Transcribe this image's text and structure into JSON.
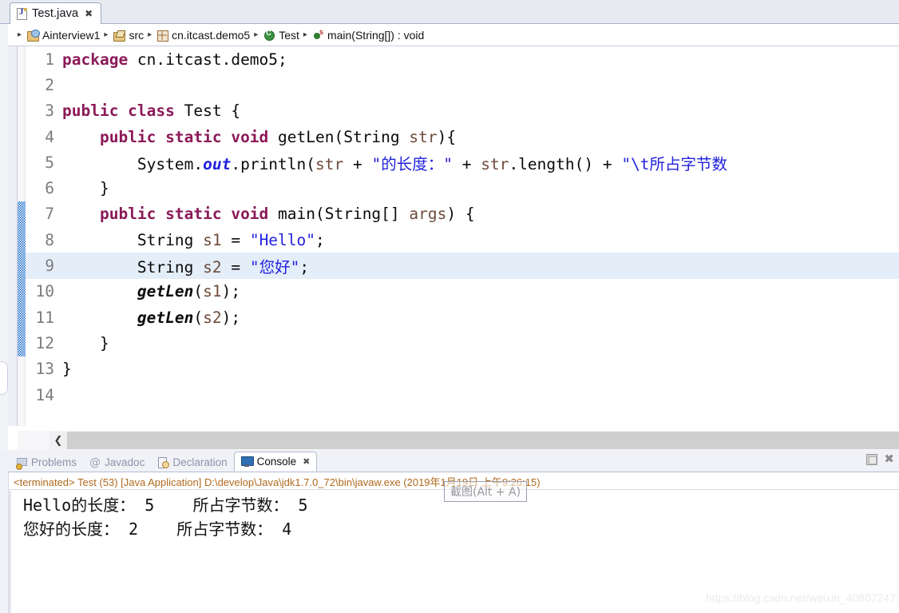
{
  "window": {
    "editor_tab": {
      "label": "Test.java",
      "icon": "java-file-icon",
      "close_glyph": "✖"
    }
  },
  "breadcrumb": {
    "items": [
      {
        "label": "Ainterview1",
        "icon": "java-project-icon"
      },
      {
        "label": "src",
        "icon": "source-folder-icon"
      },
      {
        "label": "cn.itcast.demo5",
        "icon": "package-icon"
      },
      {
        "label": "Test",
        "icon": "java-class-icon"
      },
      {
        "label": "main(String[]) : void",
        "icon": "static-method-icon"
      }
    ],
    "separator": "▸"
  },
  "editor": {
    "current_line": 9,
    "change_bar_from_line": 7,
    "change_bar_to_line": 12,
    "scroll_left_glyph": "❮",
    "lines": [
      {
        "n": "1",
        "tokens": [
          {
            "t": "package",
            "c": "kw"
          },
          {
            "t": " cn.itcast.demo5;",
            "c": "pln"
          }
        ]
      },
      {
        "n": "2",
        "tokens": [
          {
            "t": "",
            "c": "pln"
          }
        ]
      },
      {
        "n": "3",
        "tokens": [
          {
            "t": "public class",
            "c": "kw"
          },
          {
            "t": " Test {",
            "c": "pln"
          }
        ]
      },
      {
        "n": "4",
        "tokens": [
          {
            "t": "    ",
            "c": "pln"
          },
          {
            "t": "public static void",
            "c": "kw"
          },
          {
            "t": " getLen(String ",
            "c": "pln"
          },
          {
            "t": "str",
            "c": "prm"
          },
          {
            "t": "){",
            "c": "pln"
          }
        ]
      },
      {
        "n": "5",
        "tokens": [
          {
            "t": "        System.",
            "c": "pln"
          },
          {
            "t": "out",
            "c": "fld"
          },
          {
            "t": ".println(",
            "c": "pln"
          },
          {
            "t": "str",
            "c": "prm"
          },
          {
            "t": " + ",
            "c": "pln"
          },
          {
            "t": "\"的长度：\"",
            "c": "str"
          },
          {
            "t": " + ",
            "c": "pln"
          },
          {
            "t": "str",
            "c": "prm"
          },
          {
            "t": ".length() + ",
            "c": "pln"
          },
          {
            "t": "\"\\t所占字节数",
            "c": "str"
          }
        ]
      },
      {
        "n": "6",
        "tokens": [
          {
            "t": "    }",
            "c": "pln"
          }
        ]
      },
      {
        "n": "7",
        "tokens": [
          {
            "t": "    ",
            "c": "pln"
          },
          {
            "t": "public static void",
            "c": "kw"
          },
          {
            "t": " main(String[] ",
            "c": "pln"
          },
          {
            "t": "args",
            "c": "prm"
          },
          {
            "t": ") {",
            "c": "pln"
          }
        ]
      },
      {
        "n": "8",
        "tokens": [
          {
            "t": "        String ",
            "c": "pln"
          },
          {
            "t": "s1",
            "c": "prm"
          },
          {
            "t": " = ",
            "c": "pln"
          },
          {
            "t": "\"Hello\"",
            "c": "str"
          },
          {
            "t": ";",
            "c": "pln"
          }
        ]
      },
      {
        "n": "9",
        "tokens": [
          {
            "t": "        String ",
            "c": "pln"
          },
          {
            "t": "s2",
            "c": "prm"
          },
          {
            "t": " = ",
            "c": "pln"
          },
          {
            "t": "\"您好\"",
            "c": "str"
          },
          {
            "t": ";",
            "c": "pln"
          }
        ]
      },
      {
        "n": "10",
        "tokens": [
          {
            "t": "        ",
            "c": "pln"
          },
          {
            "t": "getLen",
            "c": "mth"
          },
          {
            "t": "(",
            "c": "pln"
          },
          {
            "t": "s1",
            "c": "prm"
          },
          {
            "t": ");",
            "c": "pln"
          }
        ]
      },
      {
        "n": "11",
        "tokens": [
          {
            "t": "        ",
            "c": "pln"
          },
          {
            "t": "getLen",
            "c": "mth"
          },
          {
            "t": "(",
            "c": "pln"
          },
          {
            "t": "s2",
            "c": "prm"
          },
          {
            "t": ");",
            "c": "pln"
          }
        ]
      },
      {
        "n": "12",
        "tokens": [
          {
            "t": "    }",
            "c": "pln"
          }
        ]
      },
      {
        "n": "13",
        "tokens": [
          {
            "t": "}",
            "c": "pln"
          }
        ]
      },
      {
        "n": "14",
        "tokens": [
          {
            "t": "",
            "c": "pln"
          }
        ]
      }
    ]
  },
  "bottom_view": {
    "tabs": [
      {
        "label": "Problems",
        "icon": "problems-icon",
        "active": false
      },
      {
        "label": "Javadoc",
        "icon": "javadoc-icon",
        "active": false,
        "glyph": "@"
      },
      {
        "label": "Declaration",
        "icon": "declaration-icon",
        "active": false
      },
      {
        "label": "Console",
        "icon": "console-icon",
        "active": true
      }
    ],
    "close_glyph": "✖",
    "toolbar": {
      "minimize_name": "minimize-button",
      "close_glyph": "✖"
    }
  },
  "console": {
    "header": "<terminated> Test (53) [Java Application] D:\\develop\\Java\\jdk1.7.0_72\\bin\\javaw.exe (2019年1月19日 上午9:26:15)",
    "output_lines": [
      "Hello的长度： 5    所占字节数： 5",
      "您好的长度： 2    所占字节数： 4"
    ]
  },
  "overlay": {
    "tooltip": "截图(Alt + A)",
    "watermark": "https://blog.csdn.net/weixin_40807247"
  },
  "colors": {
    "keyword": "#8b1a58",
    "string": "#2222dd",
    "field": "#2222dd",
    "param": "#6e4b3a",
    "current_line_bg": "#e4eef9",
    "change_bar": "#1567c8",
    "console_header": "#b06a1c",
    "chrome": "#f1f2f7"
  }
}
